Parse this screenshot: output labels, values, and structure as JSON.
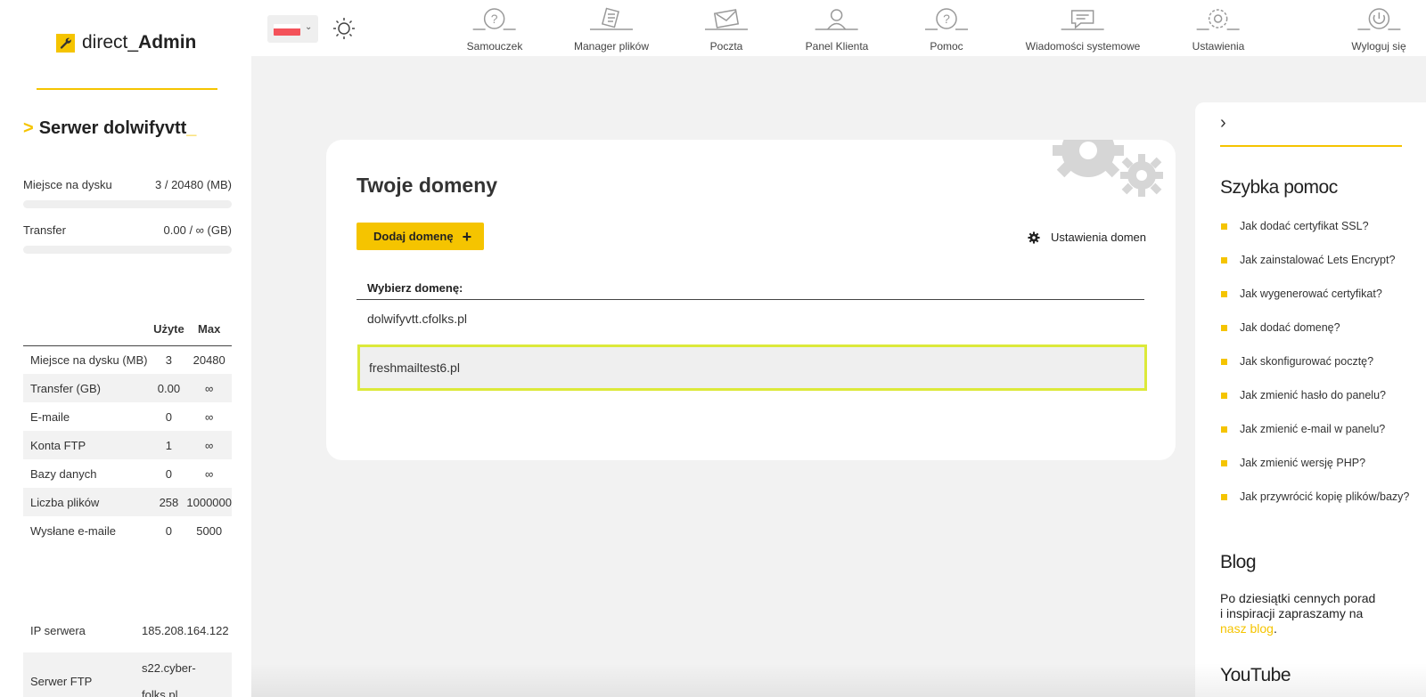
{
  "brand": {
    "name_prefix": "direct_",
    "name_bold": "Admin"
  },
  "server": {
    "arrow": ">",
    "name": "Serwer dolwifyvtt",
    "cursor": "_"
  },
  "stats": [
    {
      "label": "Miejsce na dysku",
      "value": "3 / 20480 (MB)",
      "fill": 0.0001
    },
    {
      "label": "Transfer",
      "value": "0.00 / ∞ (GB)",
      "fill": 0
    }
  ],
  "usage": {
    "headers": [
      "",
      "Użyte",
      "Max"
    ],
    "rows": [
      {
        "label": "Miejsce na dysku (MB)",
        "used": "3",
        "max": "20480"
      },
      {
        "label": "Transfer (GB)",
        "used": "0.00",
        "max": "∞"
      },
      {
        "label": "E-maile",
        "used": "0",
        "max": "∞"
      },
      {
        "label": "Konta FTP",
        "used": "1",
        "max": "∞"
      },
      {
        "label": "Bazy danych",
        "used": "0",
        "max": "∞"
      },
      {
        "label": "Liczba plików",
        "used": "258",
        "max": "1000000"
      },
      {
        "label": "Wysłane e-maile",
        "used": "0",
        "max": "5000"
      }
    ]
  },
  "server_info": [
    {
      "label": "IP serwera",
      "value": "185.208.164.122"
    },
    {
      "label": "Serwer FTP",
      "value_line1": "s22.cyber-",
      "value_line2": "folks.pl"
    }
  ],
  "nav": [
    {
      "label": "Samouczek",
      "icon": "tutorial-icon"
    },
    {
      "label": "Manager plików",
      "icon": "file-manager-icon"
    },
    {
      "label": "Poczta",
      "icon": "mail-icon"
    },
    {
      "label": "Panel Klienta",
      "icon": "client-panel-icon"
    },
    {
      "label": "Pomoc",
      "icon": "help-icon"
    },
    {
      "label": "Wiadomości systemowe",
      "icon": "system-messages-icon"
    },
    {
      "label": "Ustawienia",
      "icon": "settings-icon"
    },
    {
      "label": "Wyloguj się",
      "icon": "logout-icon"
    }
  ],
  "domains": {
    "title": "Twoje domeny",
    "add_label": "Dodaj domenę",
    "settings_label": "Ustawienia domen",
    "select_label": "Wybierz domenę:",
    "items": [
      "dolwifyvtt.cfolks.pl",
      "freshmailtest6.pl"
    ]
  },
  "help": {
    "title": "Szybka pomoc",
    "items": [
      "Jak dodać certyfikat SSL?",
      "Jak zainstalować Lets Encrypt?",
      "Jak wygenerować certyfikat?",
      "Jak dodać domenę?",
      "Jak skonfigurować pocztę?",
      "Jak zmienić hasło do panelu?",
      "Jak zmienić e-mail w panelu?",
      "Jak zmienić wersję PHP?",
      "Jak przywrócić kopię plików/bazy?"
    ]
  },
  "blog": {
    "title": "Blog",
    "text_line1": "Po dziesiątki cennych porad",
    "text_line2": "i inspiracji zapraszamy na",
    "link": "nasz blog",
    "suffix": "."
  },
  "youtube": {
    "title": "YouTube"
  },
  "colors": {
    "accent": "#f5c400",
    "highlight_border": "#dce93a",
    "flag_red": "#f4525a"
  }
}
